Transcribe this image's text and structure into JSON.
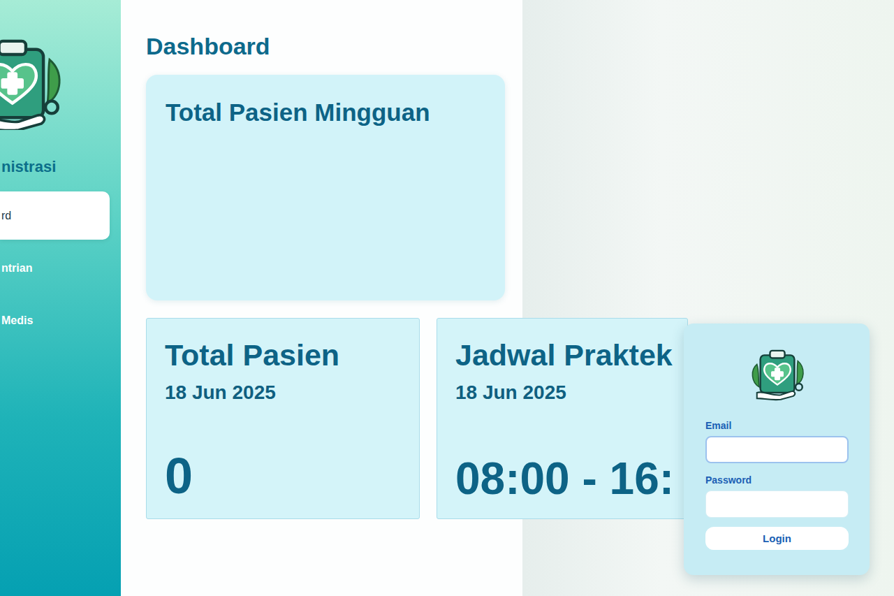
{
  "sidebar": {
    "title": "nistrasi",
    "items": [
      {
        "label": "rd",
        "selected": true
      },
      {
        "label": "ntrian",
        "selected": false
      },
      {
        "label": "Medis",
        "selected": false
      }
    ]
  },
  "page": {
    "title": "Dashboard"
  },
  "weekly_card": {
    "title": "Total Pasien Mingguan"
  },
  "stat_cards": [
    {
      "title": "Total Pasien",
      "date": "18 Jun 2025",
      "value": "0"
    },
    {
      "title": "Jadwal Praktek",
      "date": "18 Jun 2025",
      "value": "08:00 - 16:"
    }
  ],
  "login": {
    "fields": [
      {
        "label": "Email",
        "focused": true
      },
      {
        "label": "Password",
        "focused": false
      }
    ],
    "button": "Login"
  }
}
